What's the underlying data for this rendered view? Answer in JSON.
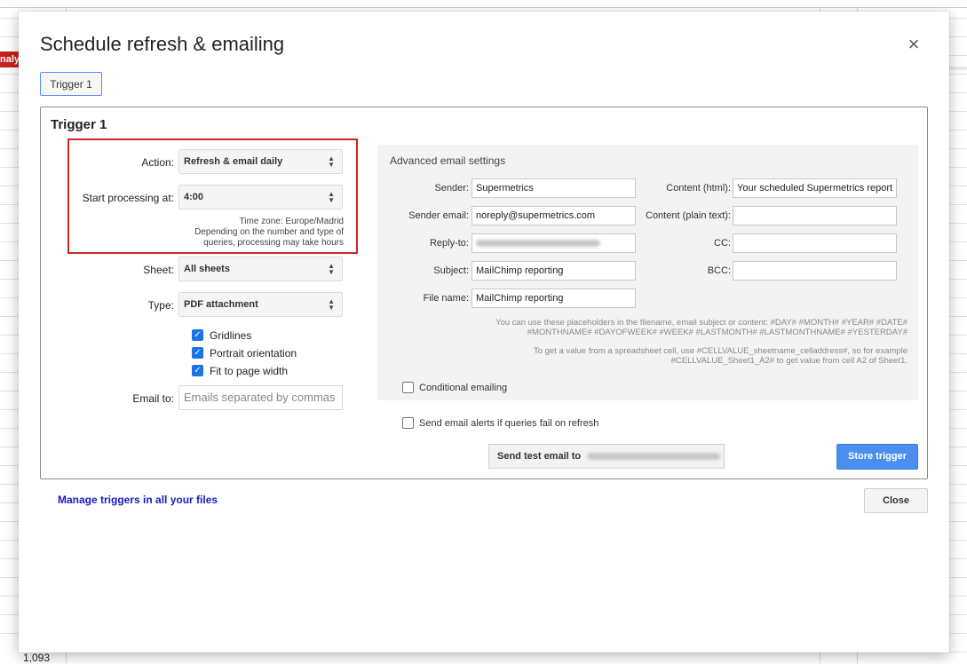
{
  "background": {
    "red_cell_text": "naly",
    "row_number": "1,093"
  },
  "dialog": {
    "title": "Schedule refresh & emailing",
    "close_symbol": "×",
    "tabs": [
      {
        "label": "Trigger 1"
      }
    ],
    "trigger": {
      "heading": "Trigger 1",
      "action_label": "Action:",
      "action_value": "Refresh & email daily",
      "start_label": "Start processing at:",
      "start_value": "4:00",
      "timezone_note": "Time zone: Europe/Madrid",
      "processing_note": "Depending on the number and type of queries, processing may take hours",
      "sheet_label": "Sheet:",
      "sheet_value": "All sheets",
      "type_label": "Type:",
      "type_value": "PDF attachment",
      "checkboxes": [
        {
          "label": "Gridlines",
          "checked": true
        },
        {
          "label": "Portrait orientation",
          "checked": true
        },
        {
          "label": "Fit to page width",
          "checked": true
        }
      ],
      "email_to_label": "Email to:",
      "email_to_placeholder": "Emails separated by commas"
    },
    "advanced": {
      "title": "Advanced email settings",
      "sender_label": "Sender:",
      "sender_value": "Supermetrics",
      "sender_email_label": "Sender email:",
      "sender_email_value": "noreply@supermetrics.com",
      "reply_to_label": "Reply-to:",
      "subject_label": "Subject:",
      "subject_value": "MailChimp reporting",
      "file_name_label": "File name:",
      "file_name_value": "MailChimp reporting",
      "content_html_label": "Content (html):",
      "content_html_value": "Your scheduled Supermetrics report",
      "content_plain_label": "Content (plain text):",
      "cc_label": "CC:",
      "bcc_label": "BCC:",
      "placeholders_note_1": "You can use these placeholders in the filename, email subject or content: #DAY# #MONTH# #YEAR# #DATE#",
      "placeholders_note_2": "#MONTHNAME# #DAYOFWEEK# #WEEK# #LASTMONTH# #LASTMONTHNAME# #YESTERDAY#",
      "cellvalue_note_1": "To get a value from a spreadsheet cell, use #CELLVALUE_sheetname_celladdress#, so for example",
      "cellvalue_note_2": "#CELLVALUE_Sheet1_A2# to get value from cell A2 of Sheet1.",
      "conditional_label": "Conditional emailing"
    },
    "alerts_label": "Send email alerts if queries fail on refresh",
    "test_email_label": "Send test email to",
    "store_trigger_label": "Store trigger",
    "manage_link": "Manage triggers in all your files",
    "close_label": "Close"
  }
}
